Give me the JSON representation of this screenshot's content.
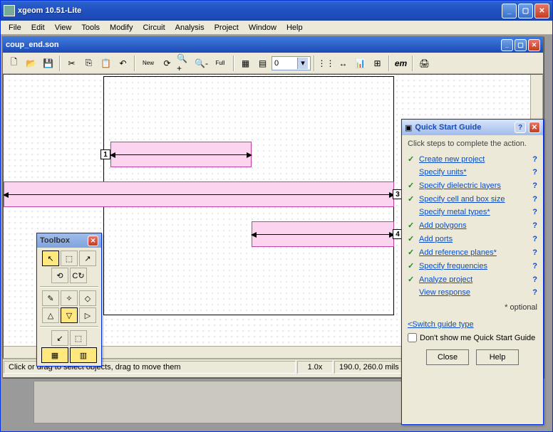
{
  "app": {
    "title": "xgeom 10.51-Lite"
  },
  "menubar": [
    "File",
    "Edit",
    "View",
    "Tools",
    "Modify",
    "Circuit",
    "Analysis",
    "Project",
    "Window",
    "Help"
  ],
  "doc": {
    "title": "coup_end.son"
  },
  "toolbar": {
    "combo_value": "0",
    "icons": {
      "new": "🗋",
      "open": "📂",
      "save": "💾",
      "cut": "✂",
      "copy": "⎘",
      "paste": "📋",
      "undo": "↶",
      "newfile": "New",
      "refresh": "⟳",
      "zoomin": "🔍+",
      "zoomout": "🔍-",
      "full": "Full",
      "grid": "▦",
      "layers": "▤",
      "measure": "⋮⋮",
      "snap": "↔",
      "graph": "📊",
      "extra": "⊞",
      "em": "em",
      "print": "🖨"
    }
  },
  "canvas": {
    "ports": {
      "p1": "1",
      "p3": "3",
      "p4": "4"
    }
  },
  "toolbox": {
    "title": "Toolbox",
    "rows": [
      [
        "↖",
        "⬚",
        "↗"
      ],
      [
        "⟲",
        "C↻"
      ],
      [
        "✎",
        "✧",
        "◇"
      ],
      [
        "△",
        "▽",
        "▷"
      ],
      [
        "↙",
        "⬚"
      ],
      [
        "▦",
        "▥"
      ]
    ]
  },
  "qsg": {
    "title": "Quick Start Guide",
    "hint": "Click steps to complete the action.",
    "items": [
      {
        "done": true,
        "label": "Create new project"
      },
      {
        "done": false,
        "label": "Specify units*"
      },
      {
        "done": true,
        "label": "Specify dielectric layers"
      },
      {
        "done": true,
        "label": "Specify cell and box size"
      },
      {
        "done": false,
        "label": "Specify metal types*"
      },
      {
        "done": true,
        "label": "Add polygons"
      },
      {
        "done": true,
        "label": "Add ports"
      },
      {
        "done": true,
        "label": "Add reference planes*"
      },
      {
        "done": true,
        "label": "Specify frequencies"
      },
      {
        "done": true,
        "label": "Analyze project"
      },
      {
        "done": false,
        "label": "View response"
      }
    ],
    "optional": "* optional",
    "switch": "<Switch guide type",
    "dontshow": "Don't show me Quick Start Guide",
    "close": "Close",
    "help": "Help"
  },
  "statusbar": {
    "msg": "Click or drag to select objects, drag to move them",
    "zoom": "1.0x",
    "coords": "190.0, 260.0 mils"
  }
}
